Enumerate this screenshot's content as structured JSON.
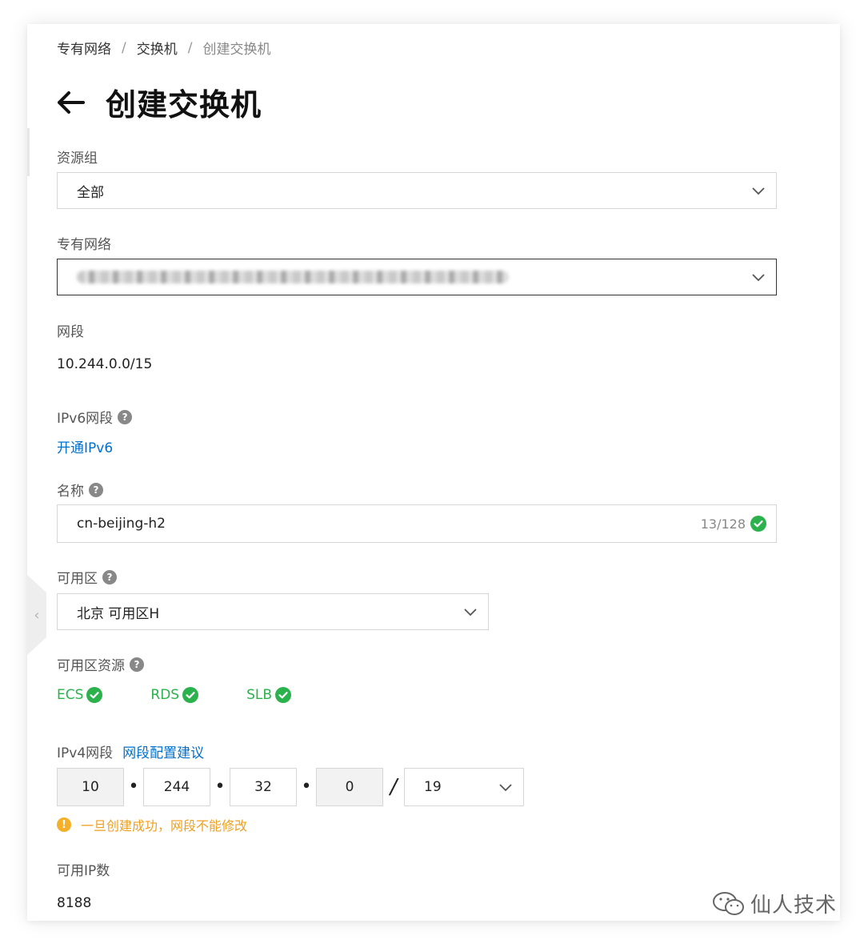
{
  "breadcrumb": [
    "专有网络",
    "交换机",
    "创建交换机"
  ],
  "page_title": "创建交换机",
  "resource_group": {
    "label": "资源组",
    "value": "全部"
  },
  "vpc": {
    "label": "专有网络",
    "value_redacted": true
  },
  "segment": {
    "label": "网段",
    "value": "10.244.0.0/15"
  },
  "ipv6": {
    "label": "IPv6网段",
    "link": "开通IPv6"
  },
  "name": {
    "label": "名称",
    "value": "cn-beijing-h2",
    "counter": "13/128"
  },
  "zone": {
    "label": "可用区",
    "value": "北京 可用区H"
  },
  "zone_resources": {
    "label": "可用区资源",
    "items": [
      "ECS",
      "RDS",
      "SLB"
    ],
    "status_color": "#2bb24c"
  },
  "ipv4": {
    "label": "IPv4网段",
    "link": "网段配置建议",
    "octets": [
      "10",
      "244",
      "32",
      "0"
    ],
    "mask": "19",
    "warning": "一旦创建成功，网段不能修改"
  },
  "available_ips": {
    "label": "可用IP数",
    "value": "8188"
  },
  "watermark": "仙人技术",
  "colors": {
    "link": "#0070cc",
    "success": "#2bb24c",
    "warning": "#f5b02a"
  }
}
